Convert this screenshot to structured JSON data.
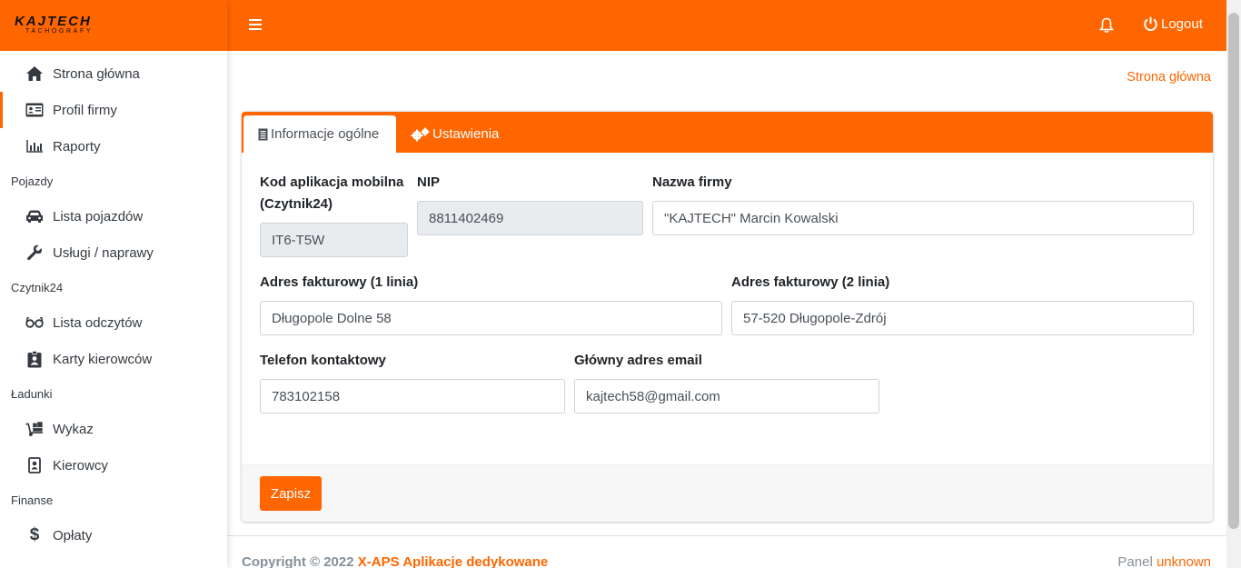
{
  "brand": {
    "name": "KAJTECH",
    "subtitle": "TACHOGRAFY"
  },
  "colors": {
    "accent": "#ff6600",
    "sidebar_bg": "#ffffff",
    "readonly_bg": "#e9ecef"
  },
  "sidebar": {
    "items": [
      {
        "label": "Strona główna",
        "icon": "home-icon"
      },
      {
        "label": "Profil firmy",
        "icon": "id-card-icon",
        "active": true
      },
      {
        "label": "Raporty",
        "icon": "chart-bar-icon"
      }
    ],
    "sections": [
      {
        "header": "Pojazdy",
        "items": [
          {
            "label": "Lista pojazdów",
            "icon": "car-icon"
          },
          {
            "label": "Usługi / naprawy",
            "icon": "wrench-icon"
          }
        ]
      },
      {
        "header": "Czytnik24",
        "items": [
          {
            "label": "Lista odczytów",
            "icon": "glasses-icon"
          },
          {
            "label": "Karty kierowców",
            "icon": "id-badge-icon"
          }
        ]
      },
      {
        "header": "Ładunki",
        "items": [
          {
            "label": "Wykaz",
            "icon": "dolly-icon"
          },
          {
            "label": "Kierowcy",
            "icon": "portrait-icon"
          }
        ]
      },
      {
        "header": "Finanse",
        "items": [
          {
            "label": "Opłaty",
            "icon": "dollar-icon"
          }
        ]
      }
    ]
  },
  "topbar": {
    "logout_label": "Logout"
  },
  "breadcrumb": "Strona główna",
  "tabs": [
    {
      "label": "Informacje ogólne",
      "icon": "document-icon",
      "active": true
    },
    {
      "label": "Ustawienia",
      "icon": "cogs-icon"
    }
  ],
  "form": {
    "mobile_code": {
      "label_line1": "Kod aplikacja mobilna",
      "label_line2": "(Czytnik24)",
      "value": "IT6-T5W"
    },
    "nip": {
      "label": "NIP",
      "value": "8811402469"
    },
    "company_name": {
      "label": "Nazwa firmy",
      "value": "\"KAJTECH\" Marcin Kowalski"
    },
    "address1": {
      "label": "Adres fakturowy (1 linia)",
      "value": "Długopole Dolne 58"
    },
    "address2": {
      "label": "Adres fakturowy (2 linia)",
      "value": "57-520 Długopole-Zdrój"
    },
    "phone": {
      "label": "Telefon kontaktowy",
      "value": "783102158"
    },
    "email": {
      "label": "Główny adres email",
      "value": "kajtech58@gmail.com"
    },
    "save_label": "Zapisz"
  },
  "footer": {
    "copyright_prefix": "Copyright © 2022 ",
    "copyright_link": "X-APS Aplikacje dedykowane",
    "panel_label": "Panel ",
    "panel_version": "unknown"
  }
}
